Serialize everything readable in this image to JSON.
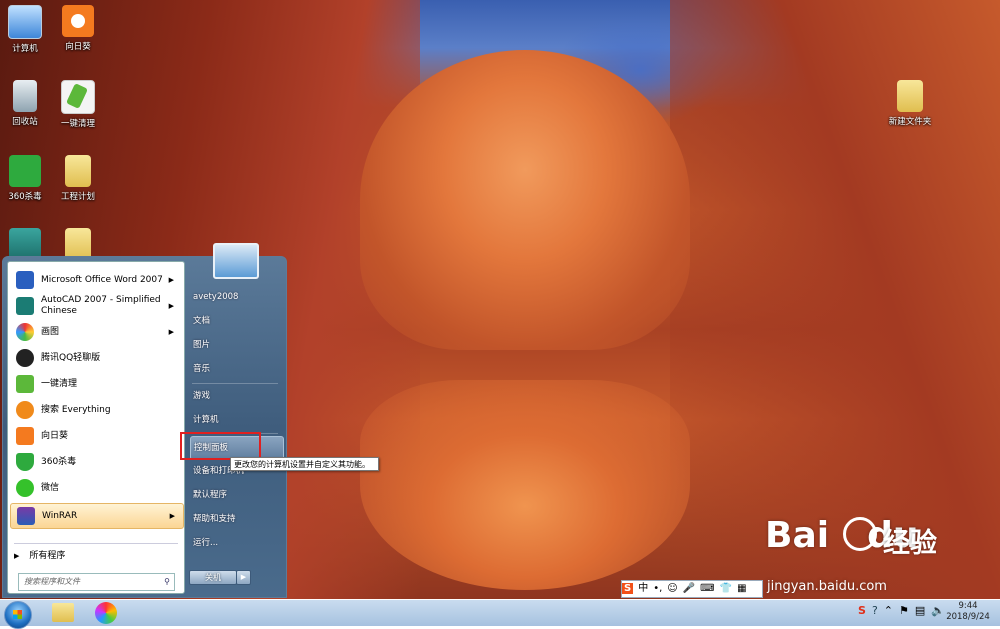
{
  "desktop": {
    "icons": [
      {
        "name": "computer",
        "label": "计算机"
      },
      {
        "name": "sunflower",
        "label": "向日葵"
      },
      {
        "name": "recycle",
        "label": "回收站"
      },
      {
        "name": "cleanup",
        "label": "一键清理"
      },
      {
        "name": "360",
        "label": "360杀毒"
      },
      {
        "name": "project",
        "label": "工程计划"
      },
      {
        "name": "new-folder",
        "label": "新建文件夹"
      }
    ]
  },
  "start_menu": {
    "programs": [
      {
        "label": "Microsoft Office Word 2007",
        "has_submenu": true
      },
      {
        "label": "AutoCAD 2007 - Simplified Chinese",
        "has_submenu": true
      },
      {
        "label": "画图",
        "has_submenu": true
      },
      {
        "label": "腾讯QQ轻聊版",
        "has_submenu": false
      },
      {
        "label": "一键清理",
        "has_submenu": false
      },
      {
        "label": "搜索 Everything",
        "has_submenu": false
      },
      {
        "label": "向日葵",
        "has_submenu": false
      },
      {
        "label": "360杀毒",
        "has_submenu": false
      },
      {
        "label": "微信",
        "has_submenu": false
      },
      {
        "label": "WinRAR",
        "has_submenu": true
      }
    ],
    "all_programs": "所有程序",
    "search_placeholder": "搜索程序和文件",
    "right_items": [
      {
        "label": "avety2008"
      },
      {
        "label": "文档"
      },
      {
        "label": "图片"
      },
      {
        "label": "音乐"
      },
      {
        "label": "游戏"
      },
      {
        "label": "计算机"
      },
      {
        "label": "控制面板"
      },
      {
        "label": "设备和打印机"
      },
      {
        "label": "默认程序"
      },
      {
        "label": "帮助和支持"
      },
      {
        "label": "运行..."
      }
    ],
    "shutdown": "关机",
    "tooltip": "更改您的计算机设置并自定义其功能。"
  },
  "ime": {
    "items": [
      "中",
      "•,",
      "☺",
      "🎤",
      "⌨",
      "👕",
      "▦"
    ]
  },
  "taskbar": {
    "time": "9:44",
    "date": "2018/9/24"
  },
  "watermark": {
    "logo": "Bai",
    "logo2": "du",
    "cn": "经验",
    "url": "jingyan.baidu.com"
  },
  "colors": {
    "highlight": "#fbd594",
    "annotation": "#e02020",
    "taskbar": "#b6cce4"
  }
}
